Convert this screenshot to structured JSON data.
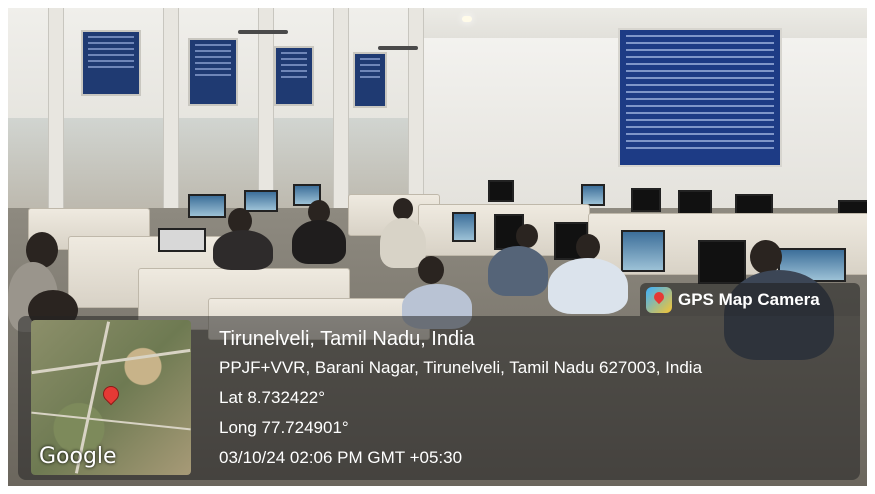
{
  "overlay": {
    "app_name": "GPS Map Camera",
    "city": "Tirunelveli, Tamil Nadu, India",
    "address": "PPJF+VVR, Barani Nagar, Tirunelveli, Tamil Nadu 627003, India",
    "latitude": "Lat 8.732422°",
    "longitude": "Long 77.724901°",
    "datetime": "03/10/24 02:06 PM GMT +05:30",
    "map_provider": "Google",
    "icons": [
      "gps-map-camera-logo-icon",
      "map-pin-icon"
    ],
    "colors": {
      "overlay_bg": "#232323",
      "pin": "#e53935",
      "text": "#ffffff"
    }
  }
}
